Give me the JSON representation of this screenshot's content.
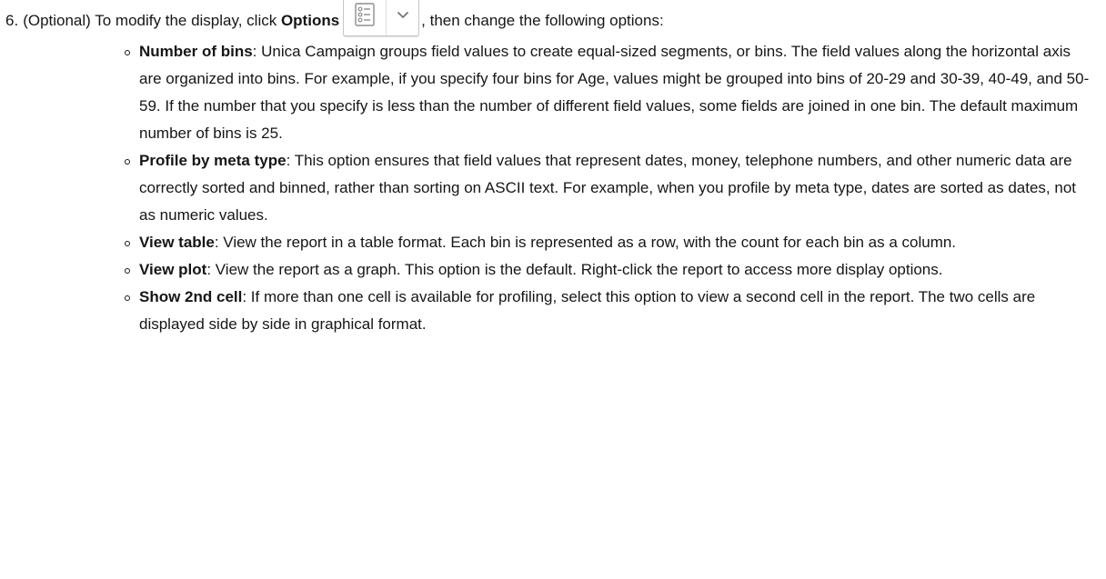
{
  "step": {
    "number": "6.",
    "intro_before": "(Optional) To modify the display, click ",
    "options_label": "Options",
    "intro_after": ", then change the following options:",
    "options_button": {
      "icon": "list-options-icon",
      "dropdown_icon": "chevron-down-icon"
    }
  },
  "options": [
    {
      "term": "Number of bins",
      "description": ": Unica Campaign groups field values to create equal-sized segments, or bins. The field values along the horizontal axis are organized into bins. For example, if you specify four bins for Age, values might be grouped into bins of 20-29 and 30-39, 40-49, and 50-59. If the number that you specify is less than the number of different field values, some fields are joined in one bin. The default maximum number of bins is 25."
    },
    {
      "term": "Profile by meta type",
      "description": ": This option ensures that field values that represent dates, money, telephone numbers, and other numeric data are correctly sorted and binned, rather than sorting on ASCII text. For example, when you profile by meta type, dates are sorted as dates, not as numeric values."
    },
    {
      "term": "View table",
      "description": ": View the report in a table format. Each bin is represented as a row, with the count for each bin as a column."
    },
    {
      "term": "View plot",
      "description": ": View the report as a graph. This option is the default. Right-click the report to access more display options."
    },
    {
      "term": "Show 2nd cell",
      "description": ": If more than one cell is available for profiling, select this option to view a second cell in the report. The two cells are displayed side by side in graphical format."
    }
  ]
}
